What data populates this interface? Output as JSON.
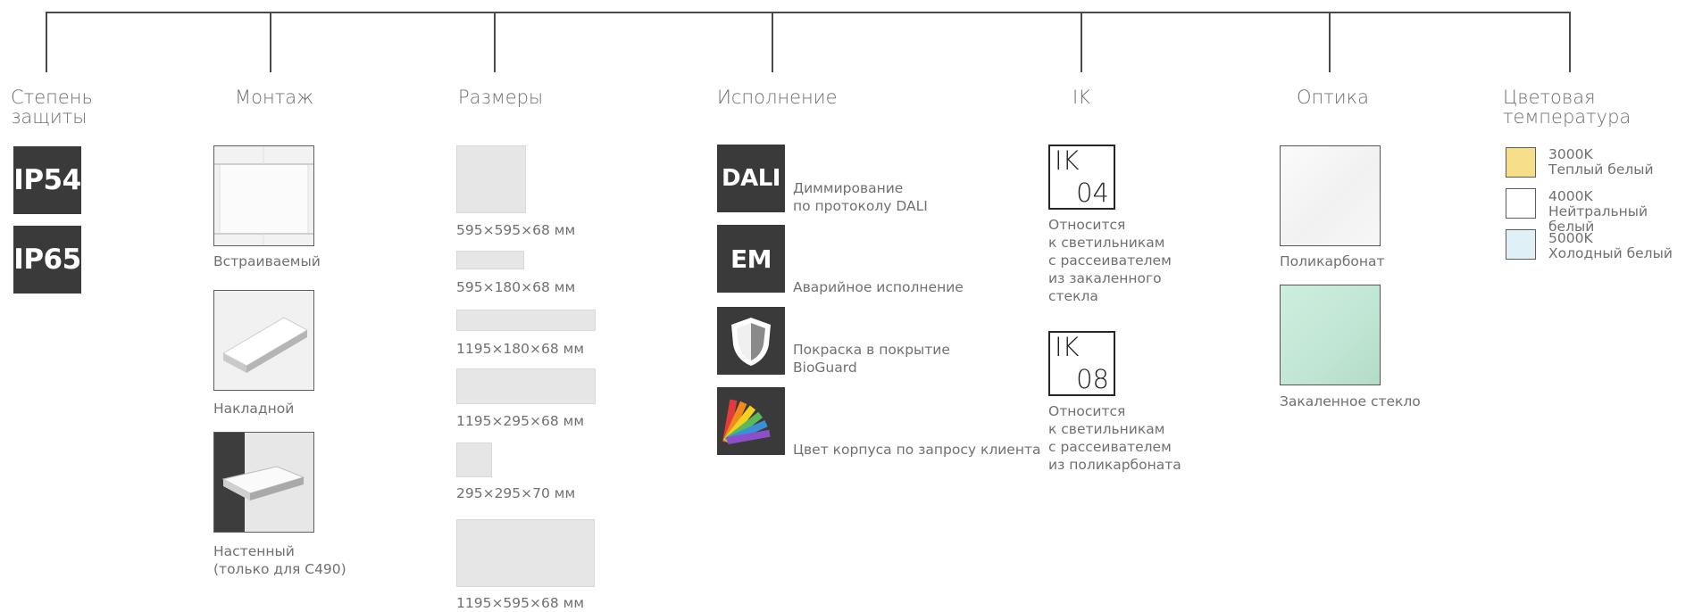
{
  "colors": {
    "line": "#4a4a4a",
    "badge_dark": "#3a3a3a",
    "text": "#707070",
    "swatch_warm": "#f7df8a",
    "swatch_neutral": "#ffffff",
    "swatch_cold": "#dff0f7",
    "optic_polycarbonate": "#f3f3f3",
    "optic_glass": "#bfe4d2"
  },
  "protection": {
    "heading": "Степень\nзащиты",
    "badges": [
      "IP54",
      "IP65"
    ]
  },
  "mounting": {
    "heading": "Монтаж",
    "items": [
      {
        "label": "Встраиваемый"
      },
      {
        "label": "Накладной"
      },
      {
        "label": "Настенный\n(только для C490)"
      }
    ]
  },
  "sizes": {
    "heading": "Размеры",
    "items": [
      {
        "label": "595×595×68 мм"
      },
      {
        "label": "595×180×68 мм"
      },
      {
        "label": "1195×180×68 мм"
      },
      {
        "label": "1195×295×68 мм"
      },
      {
        "label": "295×295×70 мм"
      },
      {
        "label": "1195×595×68 мм"
      }
    ]
  },
  "execution": {
    "heading": "Исполнение",
    "items": [
      {
        "badge": "DALI",
        "label": "Диммирование\nпо протоколу DALI",
        "icon": "dali-icon"
      },
      {
        "badge": "EM",
        "label": "Аварийное исполнение",
        "icon": "em-icon"
      },
      {
        "badge": "",
        "label": "Покраска в покрытие\nBioGuard",
        "icon": "shield-icon"
      },
      {
        "badge": "",
        "label": "Цвет корпуса по запросу клиента",
        "icon": "color-fan-icon"
      }
    ]
  },
  "ik": {
    "heading": "IK",
    "items": [
      {
        "top": "IK",
        "code": "04",
        "label": "Относится\nк светильникам\nс рассеивателем\nиз закаленного\nстекла"
      },
      {
        "top": "IK",
        "code": "08",
        "label": "Относится\nк светильникам\nс рассеивателем\nиз поликарбоната"
      }
    ]
  },
  "optics": {
    "heading": "Оптика",
    "items": [
      {
        "label": "Поликарбонат"
      },
      {
        "label": "Закаленное стекло"
      }
    ]
  },
  "color_temp": {
    "heading": "Цветовая\nтемпература",
    "items": [
      {
        "kelvin": "3000K",
        "name": "Теплый белый"
      },
      {
        "kelvin": "4000K",
        "name": "Нейтральный белый"
      },
      {
        "kelvin": "5000K",
        "name": "Холодный белый"
      }
    ]
  }
}
